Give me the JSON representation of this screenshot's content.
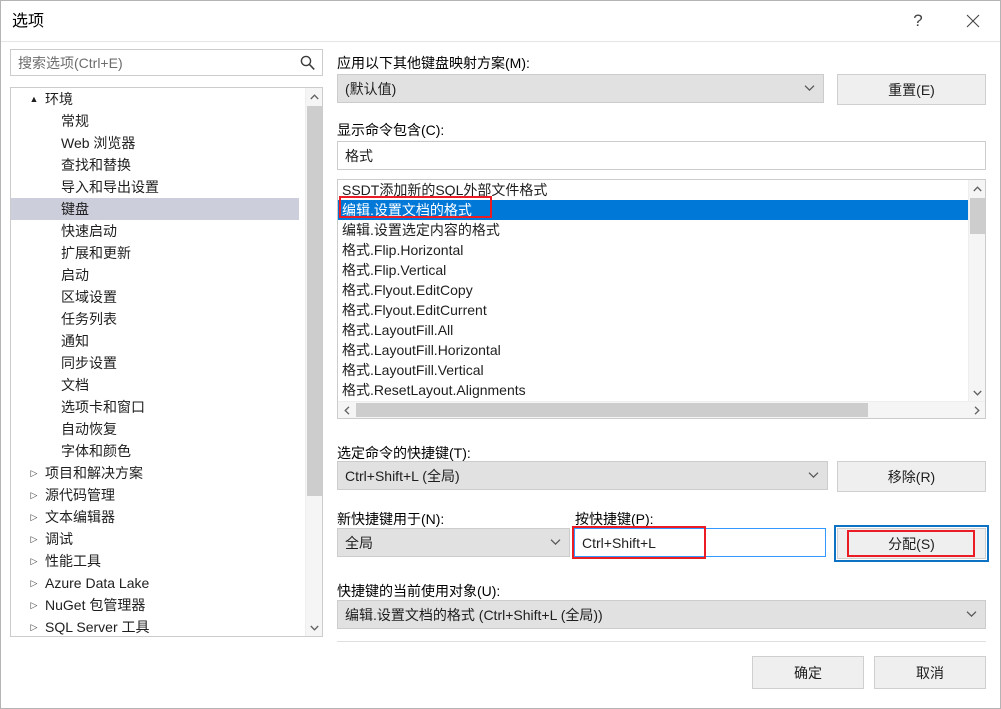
{
  "window": {
    "title": "选项",
    "help_label": "?",
    "close_label": "✕"
  },
  "search": {
    "placeholder": "搜索选项(Ctrl+E)",
    "value": "",
    "icon": "search-icon"
  },
  "tree": {
    "items": [
      {
        "label": "环境",
        "level": 0,
        "twisty": "▲",
        "expanded": true,
        "selected": false
      },
      {
        "label": "常规",
        "level": 1,
        "twisty": "",
        "expanded": false,
        "selected": false
      },
      {
        "label": "Web 浏览器",
        "level": 1,
        "twisty": "",
        "expanded": false,
        "selected": false
      },
      {
        "label": "查找和替换",
        "level": 1,
        "twisty": "",
        "expanded": false,
        "selected": false
      },
      {
        "label": "导入和导出设置",
        "level": 1,
        "twisty": "",
        "expanded": false,
        "selected": false
      },
      {
        "label": "键盘",
        "level": 1,
        "twisty": "",
        "expanded": false,
        "selected": true
      },
      {
        "label": "快速启动",
        "level": 1,
        "twisty": "",
        "expanded": false,
        "selected": false
      },
      {
        "label": "扩展和更新",
        "level": 1,
        "twisty": "",
        "expanded": false,
        "selected": false
      },
      {
        "label": "启动",
        "level": 1,
        "twisty": "",
        "expanded": false,
        "selected": false
      },
      {
        "label": "区域设置",
        "level": 1,
        "twisty": "",
        "expanded": false,
        "selected": false
      },
      {
        "label": "任务列表",
        "level": 1,
        "twisty": "",
        "expanded": false,
        "selected": false
      },
      {
        "label": "通知",
        "level": 1,
        "twisty": "",
        "expanded": false,
        "selected": false
      },
      {
        "label": "同步设置",
        "level": 1,
        "twisty": "",
        "expanded": false,
        "selected": false
      },
      {
        "label": "文档",
        "level": 1,
        "twisty": "",
        "expanded": false,
        "selected": false
      },
      {
        "label": "选项卡和窗口",
        "level": 1,
        "twisty": "",
        "expanded": false,
        "selected": false
      },
      {
        "label": "自动恢复",
        "level": 1,
        "twisty": "",
        "expanded": false,
        "selected": false
      },
      {
        "label": "字体和颜色",
        "level": 1,
        "twisty": "",
        "expanded": false,
        "selected": false
      },
      {
        "label": "项目和解决方案",
        "level": 0,
        "twisty": "▷",
        "expanded": false,
        "selected": false
      },
      {
        "label": "源代码管理",
        "level": 0,
        "twisty": "▷",
        "expanded": false,
        "selected": false
      },
      {
        "label": "文本编辑器",
        "level": 0,
        "twisty": "▷",
        "expanded": false,
        "selected": false
      },
      {
        "label": "调试",
        "level": 0,
        "twisty": "▷",
        "expanded": false,
        "selected": false
      },
      {
        "label": "性能工具",
        "level": 0,
        "twisty": "▷",
        "expanded": false,
        "selected": false
      },
      {
        "label": "Azure Data Lake",
        "level": 0,
        "twisty": "▷",
        "expanded": false,
        "selected": false
      },
      {
        "label": "NuGet 包管理器",
        "level": 0,
        "twisty": "▷",
        "expanded": false,
        "selected": false
      },
      {
        "label": "SQL Server 工具",
        "level": 0,
        "twisty": "▷",
        "expanded": false,
        "selected": false
      }
    ]
  },
  "main": {
    "mapping_label": "应用以下其他键盘映射方案(M):",
    "mapping_value": "(默认值)",
    "reset_button": "重置(E)",
    "showcmd_label": "显示命令包含(C):",
    "showcmd_value": "格式",
    "commands": [
      {
        "label": "SSDT添加新的SQL外部文件格式",
        "selected": false
      },
      {
        "label": "编辑.设置文档的格式",
        "selected": true
      },
      {
        "label": "编辑.设置选定内容的格式",
        "selected": false
      },
      {
        "label": "格式.Flip.Horizontal",
        "selected": false
      },
      {
        "label": "格式.Flip.Vertical",
        "selected": false
      },
      {
        "label": "格式.Flyout.EditCopy",
        "selected": false
      },
      {
        "label": "格式.Flyout.EditCurrent",
        "selected": false
      },
      {
        "label": "格式.LayoutFill.All",
        "selected": false
      },
      {
        "label": "格式.LayoutFill.Horizontal",
        "selected": false
      },
      {
        "label": "格式.LayoutFill.Vertical",
        "selected": false
      },
      {
        "label": "格式.ResetLayout.Alignments",
        "selected": false
      }
    ],
    "selshort_label": "选定命令的快捷键(T):",
    "selshort_value": "Ctrl+Shift+L (全局)",
    "remove_button": "移除(R)",
    "newshort_label": "新快捷键用于(N):",
    "newshort_value": "全局",
    "presskey_label": "按快捷键(P):",
    "presskey_value": "Ctrl+Shift+L",
    "assign_button": "分配(S)",
    "curuse_label": "快捷键的当前使用对象(U):",
    "curuse_value": "编辑.设置文档的格式 (Ctrl+Shift+L (全局))"
  },
  "footer": {
    "ok_button": "确定",
    "cancel_button": "取消"
  },
  "colors": {
    "selection_blue": "#0078d7",
    "tree_selection": "#cccedb",
    "annotation_red": "#ec1c24",
    "focus_blue": "#0c72c4",
    "control_gray": "#e1e1e1",
    "button_gray": "#efefef"
  },
  "scrollbars": {
    "up_arrow": "⌃",
    "down_arrow": "⌄",
    "left_arrow": "‹",
    "right_arrow": "›"
  }
}
